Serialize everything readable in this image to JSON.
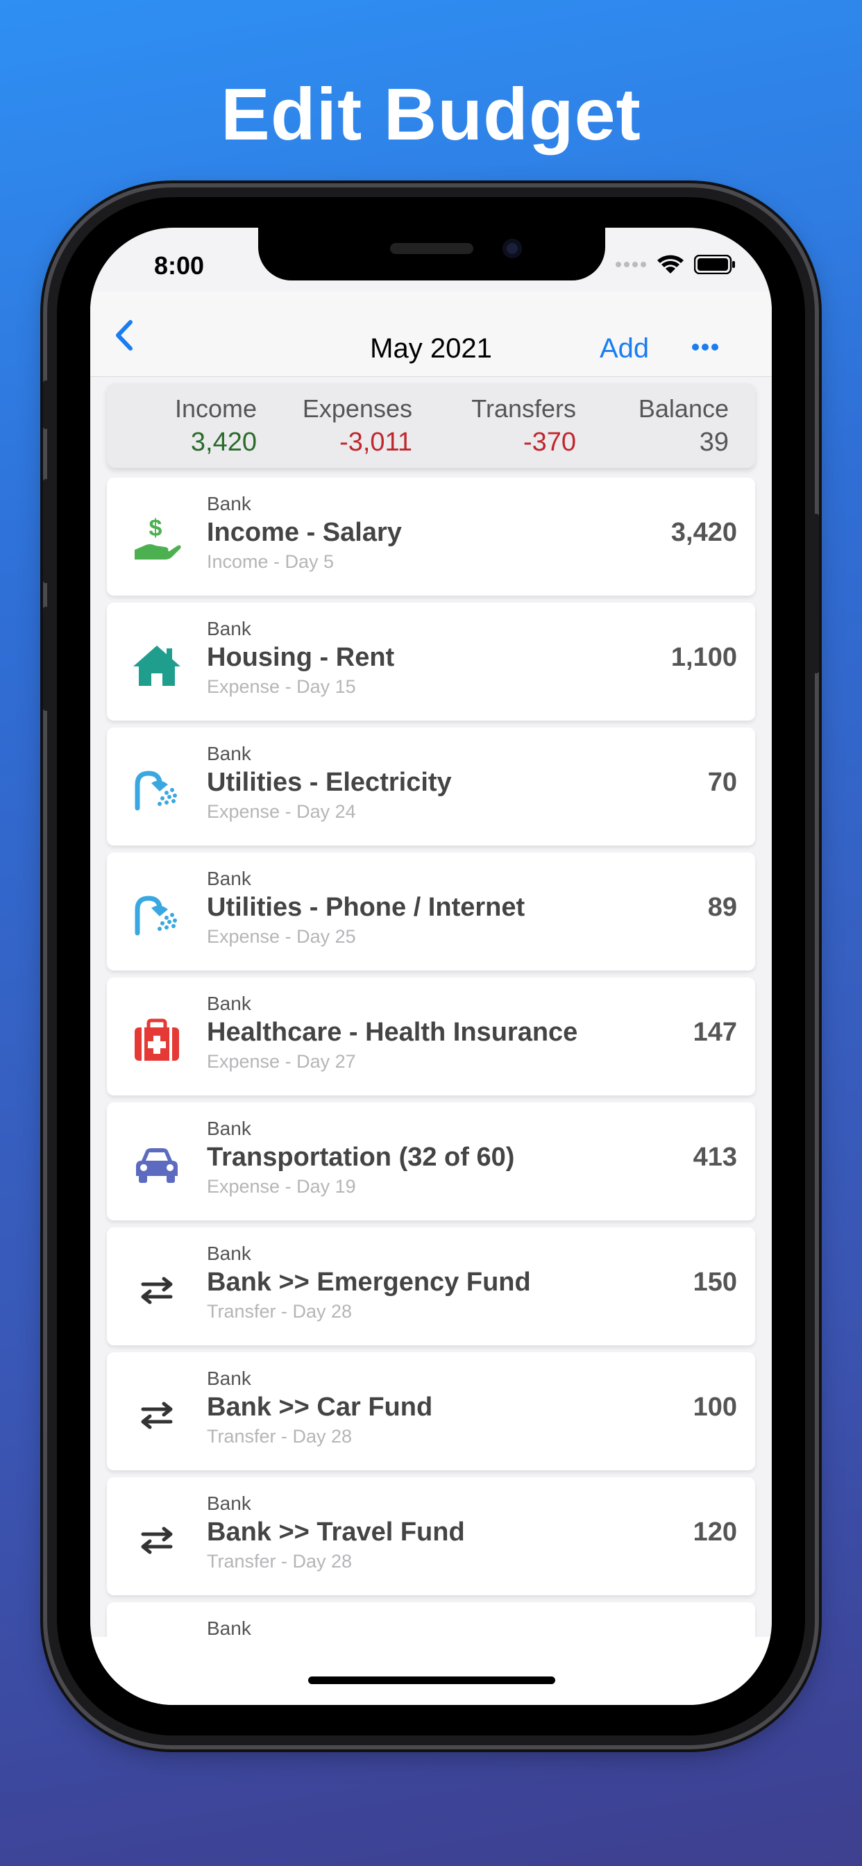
{
  "headline": "Edit Budget",
  "status": {
    "time": "8:00"
  },
  "nav": {
    "title": "May 2021",
    "add_label": "Add"
  },
  "summary": {
    "income_label": "Income",
    "income_value": "3,420",
    "expenses_label": "Expenses",
    "expenses_value": "-3,011",
    "transfers_label": "Transfers",
    "transfers_value": "-370",
    "balance_label": "Balance",
    "balance_value": "39"
  },
  "items": [
    {
      "account": "Bank",
      "title": "Income - Salary",
      "subtitle": "Income - Day 5",
      "amount": "3,420",
      "icon": "salary-hand-icon",
      "color": "#4caf50"
    },
    {
      "account": "Bank",
      "title": "Housing - Rent",
      "subtitle": "Expense - Day 15",
      "amount": "1,100",
      "icon": "house-icon",
      "color": "#1f9e8e"
    },
    {
      "account": "Bank",
      "title": "Utilities - Electricity",
      "subtitle": "Expense - Day 24",
      "amount": "70",
      "icon": "shower-icon",
      "color": "#3aa8e0"
    },
    {
      "account": "Bank",
      "title": "Utilities - Phone / Internet",
      "subtitle": "Expense - Day 25",
      "amount": "89",
      "icon": "shower-icon",
      "color": "#3aa8e0"
    },
    {
      "account": "Bank",
      "title": "Healthcare - Health Insurance",
      "subtitle": "Expense - Day 27",
      "amount": "147",
      "icon": "first-aid-kit-icon",
      "color": "#e53935"
    },
    {
      "account": "Bank",
      "title": "Transportation (32 of 60)",
      "subtitle": "Expense - Day 19",
      "amount": "413",
      "icon": "car-icon",
      "color": "#5c6bc0"
    },
    {
      "account": "Bank",
      "title": "Bank >> Emergency Fund",
      "subtitle": "Transfer - Day 28",
      "amount": "150",
      "icon": "transfer-arrows-icon",
      "color": "#333333"
    },
    {
      "account": "Bank",
      "title": "Bank >> Car Fund",
      "subtitle": "Transfer - Day 28",
      "amount": "100",
      "icon": "transfer-arrows-icon",
      "color": "#333333"
    },
    {
      "account": "Bank",
      "title": "Bank >> Travel Fund",
      "subtitle": "Transfer - Day 28",
      "amount": "120",
      "icon": "transfer-arrows-icon",
      "color": "#333333"
    },
    {
      "account": "Bank"
    }
  ],
  "colors": {
    "accent": "#1a7df0",
    "positive": "#2a6b2a",
    "negative": "#c0272d"
  }
}
